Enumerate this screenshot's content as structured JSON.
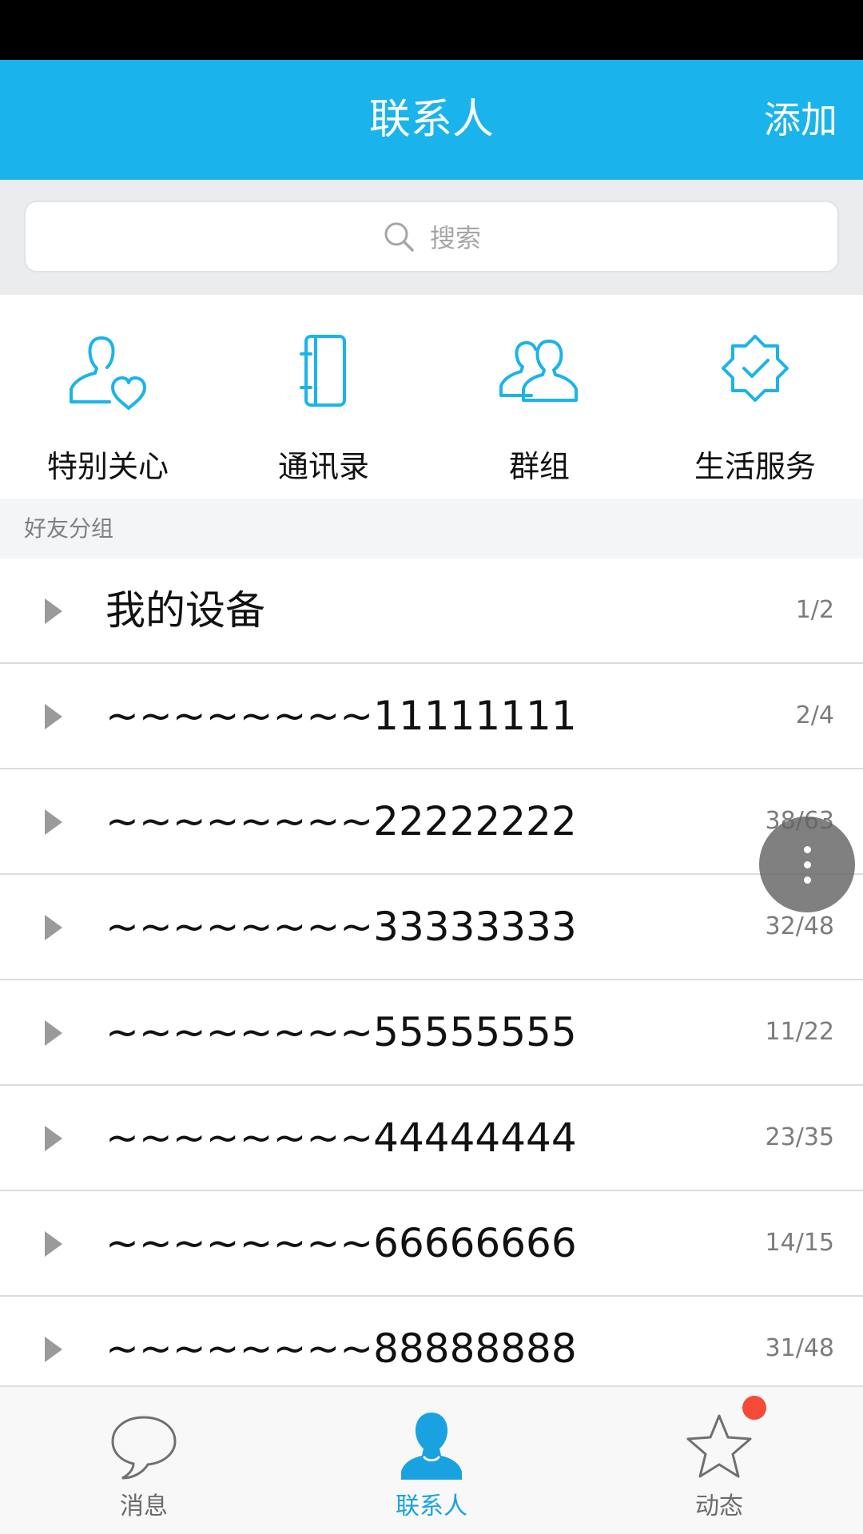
{
  "header": {
    "title": "联系人",
    "add_label": "添加",
    "background": "#1bb3eb"
  },
  "search": {
    "placeholder": "搜索",
    "icon": "search-icon"
  },
  "shortcuts": [
    {
      "label": "特别关心",
      "icon": "user-heart-icon"
    },
    {
      "label": "通讯录",
      "icon": "address-book-icon"
    },
    {
      "label": "群组",
      "icon": "group-icon"
    },
    {
      "label": "生活服务",
      "icon": "badge-check-icon"
    }
  ],
  "section": {
    "label": "好友分组"
  },
  "groups": [
    {
      "name": "我的设备",
      "count": "1/2"
    },
    {
      "name": "~~~~~~~~11111111",
      "count": "2/4"
    },
    {
      "name": "~~~~~~~~22222222",
      "count": "38/63"
    },
    {
      "name": "~~~~~~~~33333333",
      "count": "32/48"
    },
    {
      "name": "~~~~~~~~55555555",
      "count": "11/22"
    },
    {
      "name": "~~~~~~~~44444444",
      "count": "23/35"
    },
    {
      "name": "~~~~~~~~66666666",
      "count": "14/15"
    },
    {
      "name": "~~~~~~~~88888888",
      "count": "31/48"
    }
  ],
  "bottom_nav": [
    {
      "label": "消息",
      "icon": "chat-bubble-icon",
      "active": false
    },
    {
      "label": "联系人",
      "icon": "contact-person-icon",
      "active": true
    },
    {
      "label": "动态",
      "icon": "star-icon",
      "active": false,
      "badge": true
    }
  ],
  "colors": {
    "accent": "#1bb3eb",
    "active_tab": "#1aa2e0",
    "badge": "#f44a37"
  }
}
